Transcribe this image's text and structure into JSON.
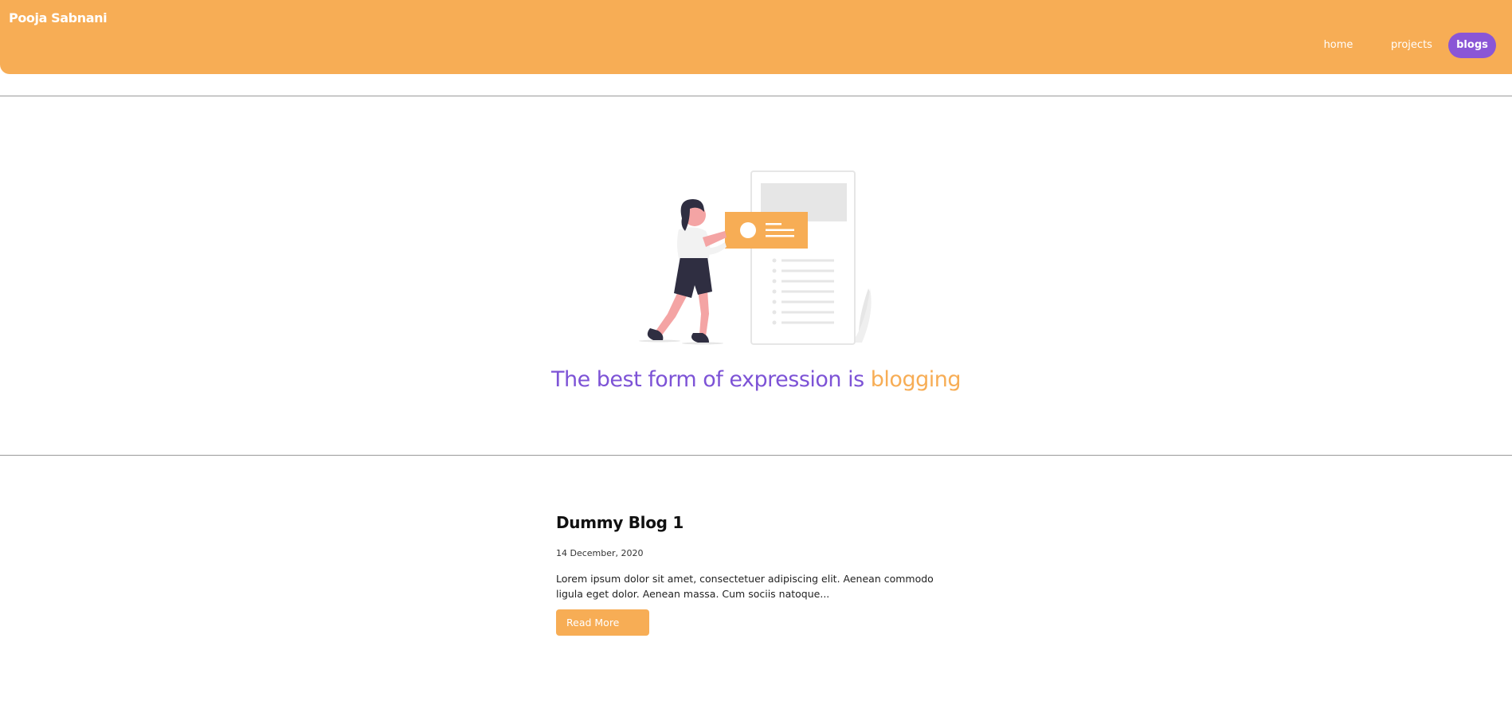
{
  "header": {
    "brand": "Pooja Sabnani",
    "nav": [
      {
        "label": "home"
      },
      {
        "label": "projects"
      },
      {
        "label": "blogs"
      }
    ]
  },
  "hero": {
    "tagline_main": "The best form of expression is",
    "tagline_accent": "blogging"
  },
  "blog": {
    "title": "Dummy Blog 1",
    "date": "14 December, 2020",
    "excerpt": "Lorem ipsum dolor sit amet, consectetuer adipiscing elit. Aenean commodo ligula eget dolor. Aenean massa. Cum sociis natoque...",
    "read_more_label": "Read More"
  },
  "colors": {
    "accent_orange": "#f7ad55",
    "accent_purple": "#7d53d6",
    "active_nav": "#8a56d6"
  }
}
